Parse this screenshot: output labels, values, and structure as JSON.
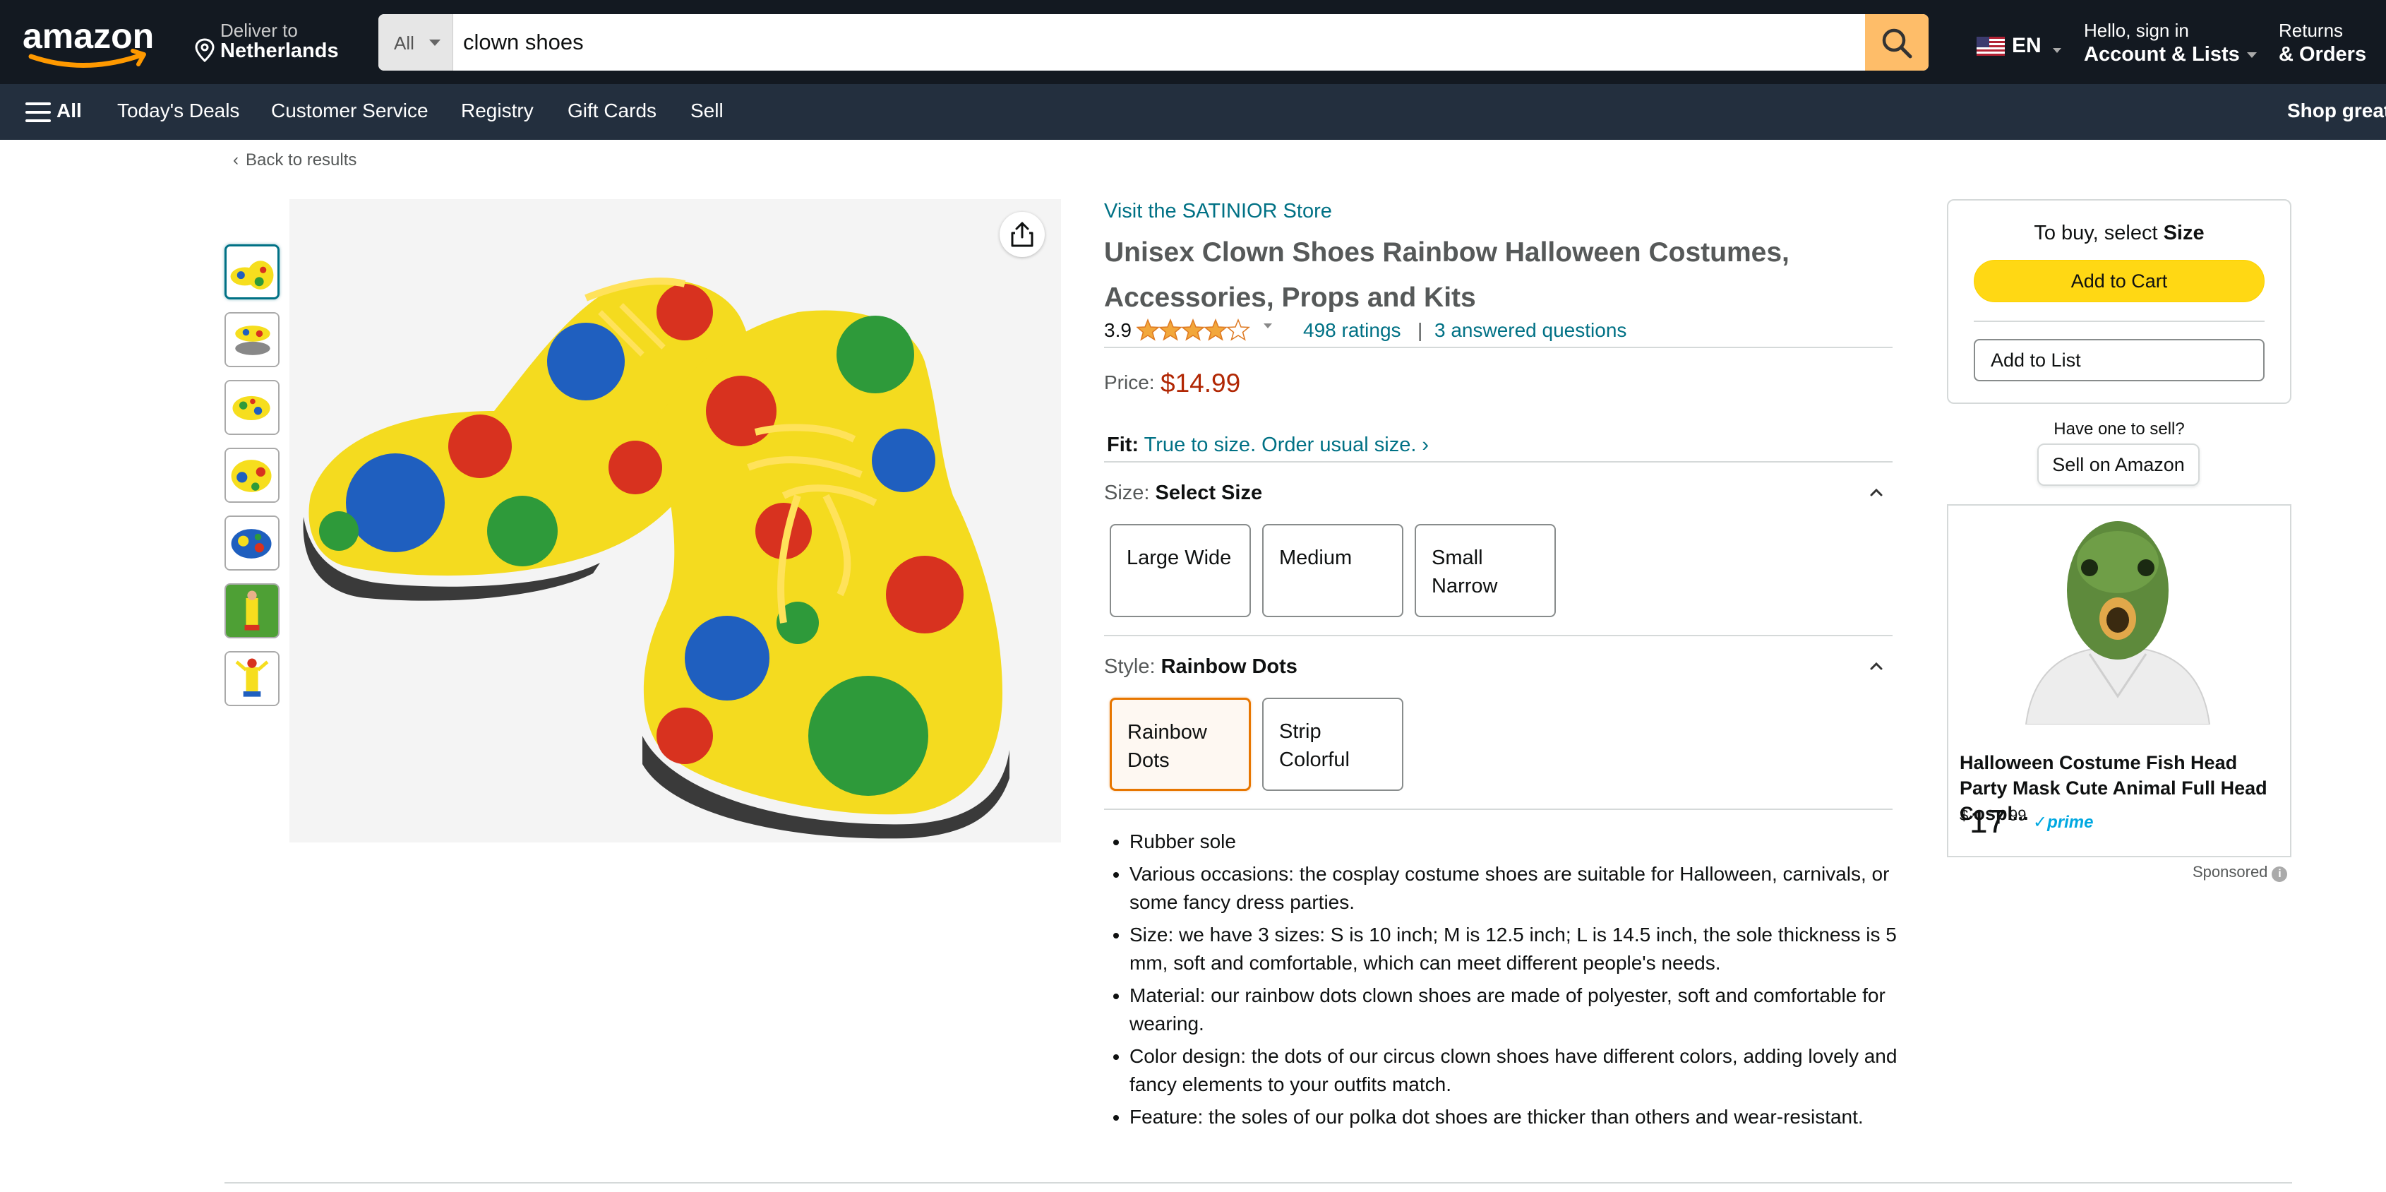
{
  "header": {
    "deliver_line1": "Deliver to",
    "deliver_line2": "Netherlands",
    "search_category": "All",
    "search_value": "clown shoes",
    "language": "EN",
    "account_line1": "Hello, sign in",
    "account_line2": "Account & Lists",
    "orders_line1": "Returns",
    "orders_line2": "& Orders"
  },
  "subnav": {
    "all": "All",
    "items": [
      "Today's Deals",
      "Customer Service",
      "Registry",
      "Gift Cards",
      "Sell"
    ],
    "right": "Shop great"
  },
  "breadcrumb": {
    "back": "Back to results"
  },
  "product": {
    "store_link": "Visit the SATINIOR Store",
    "title": "Unisex Clown Shoes Rainbow Halloween Costumes, Accessories, Props and Kits",
    "rating_value": "3.9",
    "rating_stars": 3.9,
    "ratings_count": "498 ratings",
    "separator": "|",
    "answered_questions": "3 answered questions",
    "price_label": "Price:",
    "price": "$14.99",
    "fit_label": "Fit:",
    "fit_text": "True to size. Order usual size. ›",
    "size_label": "Size:",
    "size_value": "Select Size",
    "sizes": [
      "Large Wide",
      "Medium",
      "Small Narrow"
    ],
    "style_label": "Style:",
    "style_value": "Rainbow Dots",
    "styles": [
      "Rainbow Dots",
      "Strip Colorful"
    ],
    "selected_style": "Rainbow Dots",
    "bullets": [
      "Rubber sole",
      "Various occasions: the cosplay costume shoes are suitable for Halloween, carnivals, or some fancy dress parties.",
      "Size: we have 3 sizes: S is 10 inch; M is 12.5 inch; L is 14.5 inch, the sole thickness is 5 mm, soft and comfortable, which can meet different people's needs.",
      "Material: our rainbow dots clown shoes are made of polyester, soft and comfortable for wearing.",
      "Color design: the dots of our circus clown shoes have different colors, adding lovely and fancy elements to your outfits match.",
      "Feature: the soles of our polka dot shoes are thicker than others and wear-resistant."
    ]
  },
  "buybox": {
    "heading_prefix": "To buy, select",
    "heading_bold": "Size",
    "add_to_cart": "Add to Cart",
    "add_to_list": "Add to List",
    "have_one": "Have one to sell?",
    "sell_button": "Sell on Amazon"
  },
  "ad": {
    "title": "Halloween Costume Fish Head Party Mask Cute Animal Full Head Cospl...",
    "price_symbol": "$",
    "price_whole": "17",
    "price_fraction": "99",
    "prime": "✓prime",
    "sponsored": "Sponsored"
  },
  "icons": {
    "logo": "amazon-logo",
    "location": "location-pin-icon",
    "search": "search-icon",
    "flag": "us-flag-icon",
    "menu": "hamburger-icon",
    "share": "share-icon",
    "collapse": "chevron-up-icon",
    "info": "info-icon"
  },
  "colors": {
    "nav_top": "#131921",
    "nav_sub": "#232F3E",
    "search_button": "#FEBD69",
    "link": "#007185",
    "price": "#B12704",
    "cart_button": "#FFD814",
    "selected_swatch": "#E77600"
  }
}
